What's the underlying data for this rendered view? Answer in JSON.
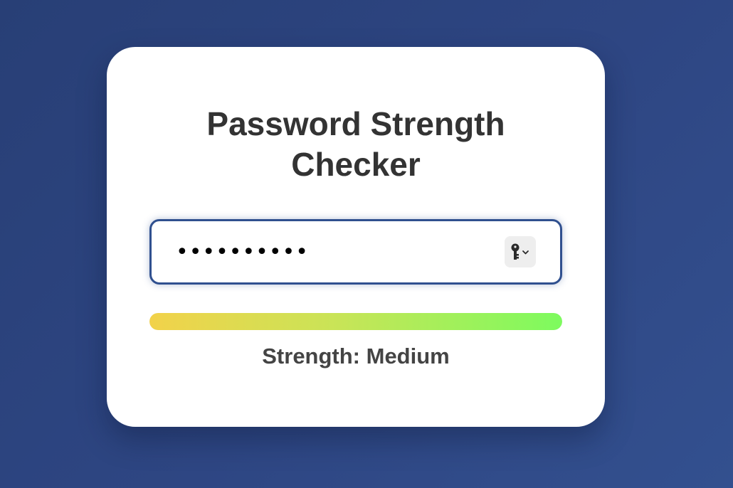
{
  "card": {
    "title_line1": "Password Strength",
    "title_line2": "Checker"
  },
  "password": {
    "value": "••••••••••",
    "masked_character_count": 10,
    "autofill_icon": "key-icon"
  },
  "strength": {
    "fill_fraction": 1.0,
    "label_prefix": "Strength:",
    "level": "Medium",
    "label": "Strength: Medium",
    "gradient_colors": [
      "#f2d24a",
      "#c9e457",
      "#7dfb5e"
    ]
  },
  "colors": {
    "background": "#2e4683",
    "card": "#ffffff",
    "input_border": "#30508f",
    "title_text": "#333333",
    "label_text": "#444444"
  }
}
